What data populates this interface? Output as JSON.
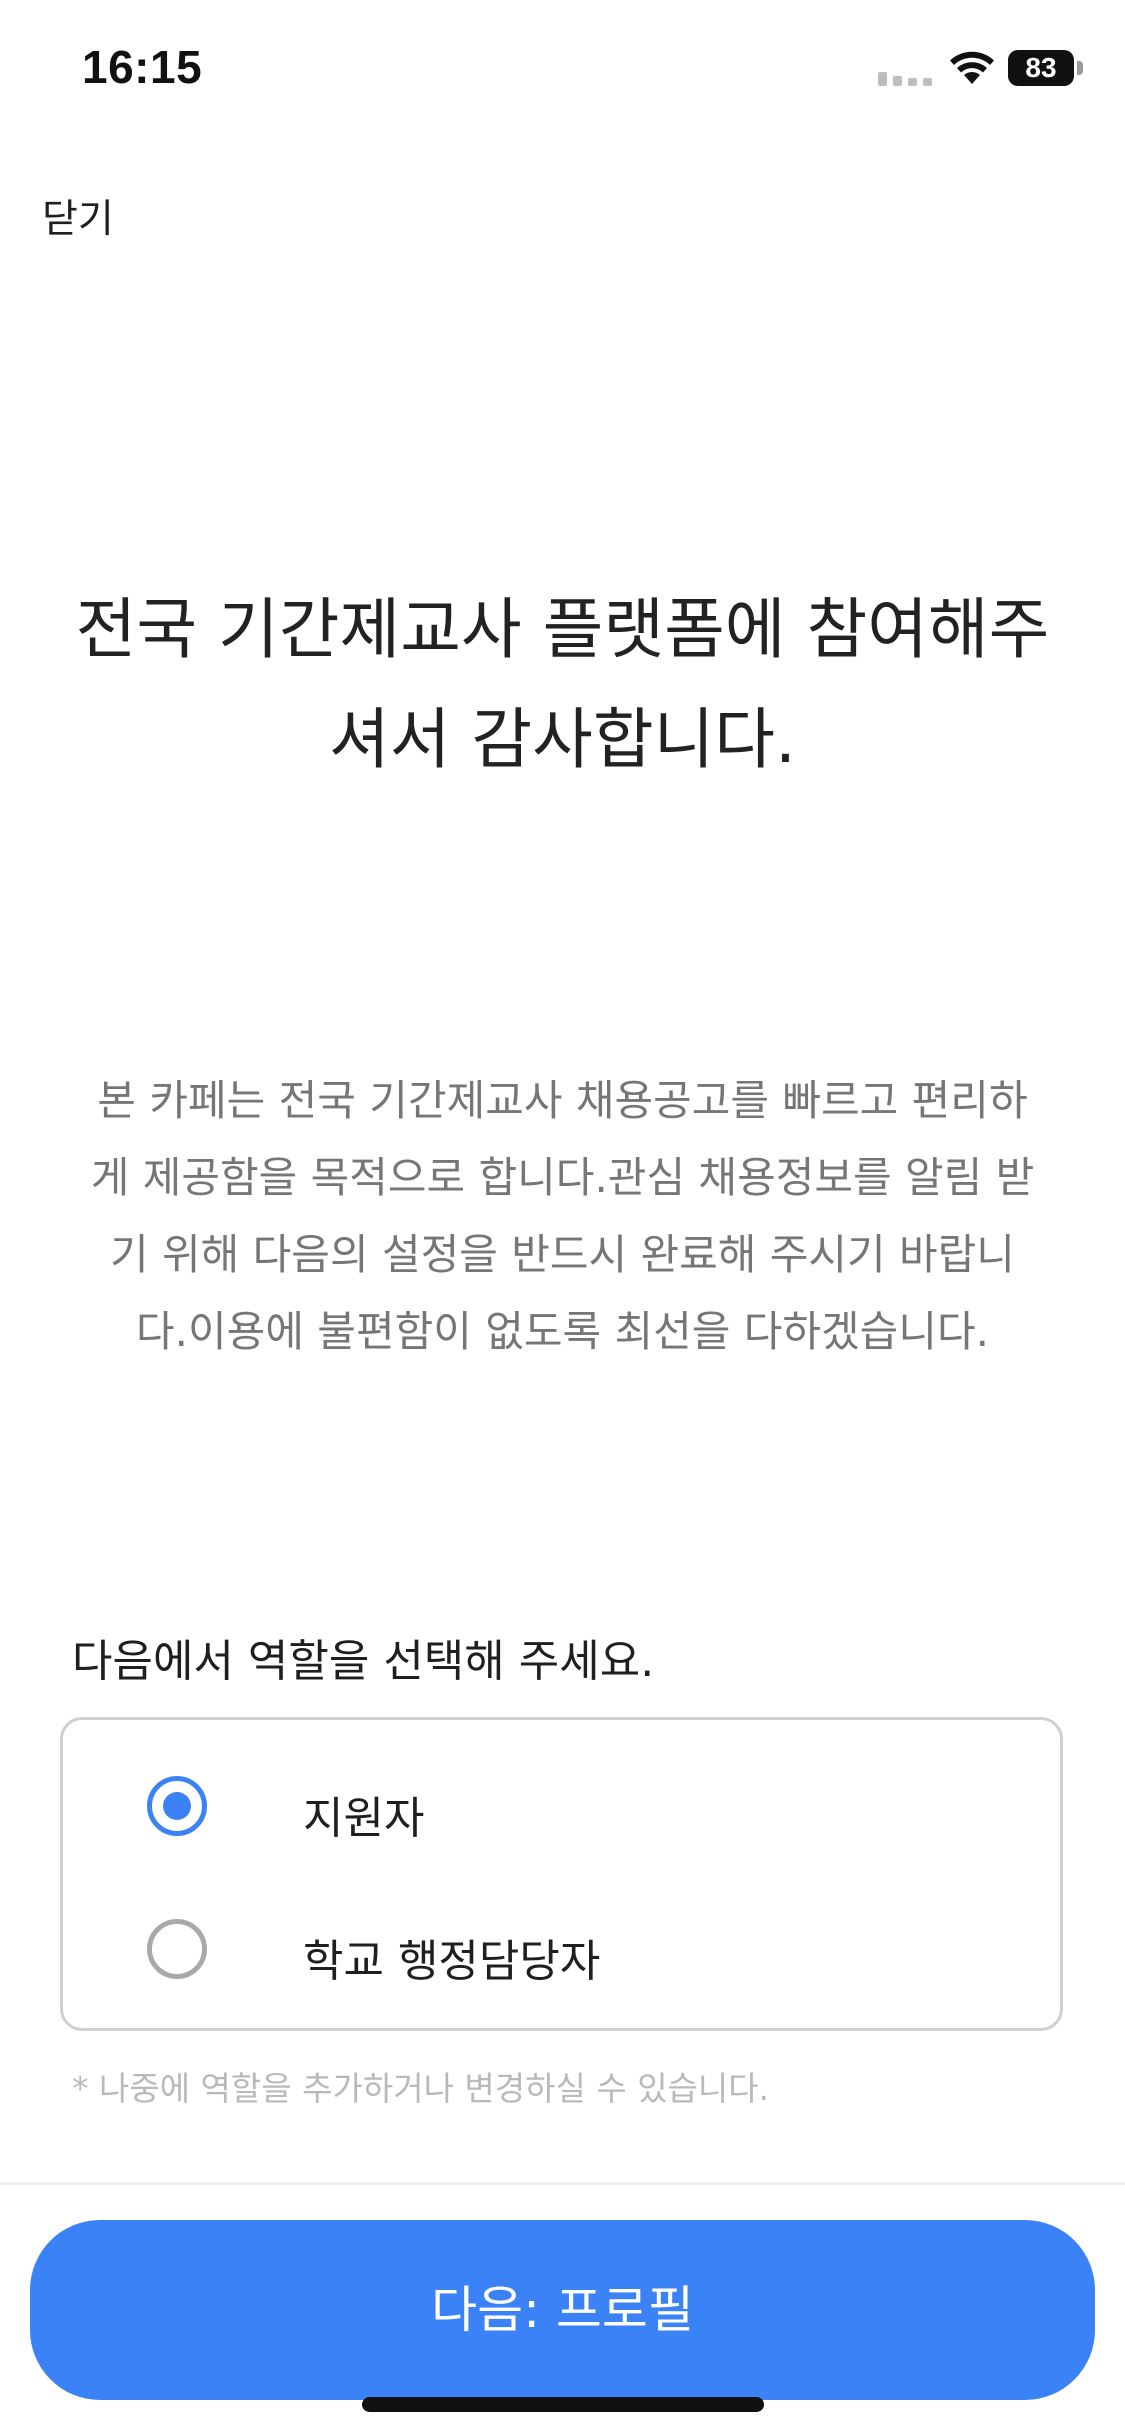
{
  "status_bar": {
    "time": "16:15",
    "battery_level": "83",
    "icons": [
      "signal-icon",
      "wifi-icon",
      "battery-icon"
    ]
  },
  "header": {
    "close_label": "닫기"
  },
  "welcome": {
    "title_line1": "전국 기간제교사 플랫폼에 참여해주",
    "title_line2": "셔서 감사합니다.",
    "description_line1": "본 카페는 전국 기간제교사 채용공고를 빠르고 편리하",
    "description_line2": "게 제공함을 목적으로 합니다.관심 채용정보를 알림 받",
    "description_line3": "기 위해 다음의 설정을 반드시 완료해 주시기 바랍니",
    "description_line4": "다.이용에 불편함이 없도록 최선을 다하겠습니다."
  },
  "role": {
    "prompt": "다음에서 역할을 선택해 주세요.",
    "options": [
      {
        "label": "지원자",
        "selected": true
      },
      {
        "label": "학교 행정담당자",
        "selected": false
      }
    ],
    "note": "* 나중에 역할을 추가하거나 변경하실 수 있습니다."
  },
  "footer": {
    "next_label": "다음: 프로필"
  },
  "colors": {
    "accent": "#3b82f6",
    "text_primary": "#1f1f1f",
    "text_secondary": "#767676",
    "text_hint": "#b9b9b9",
    "border": "#cfcfcf"
  }
}
